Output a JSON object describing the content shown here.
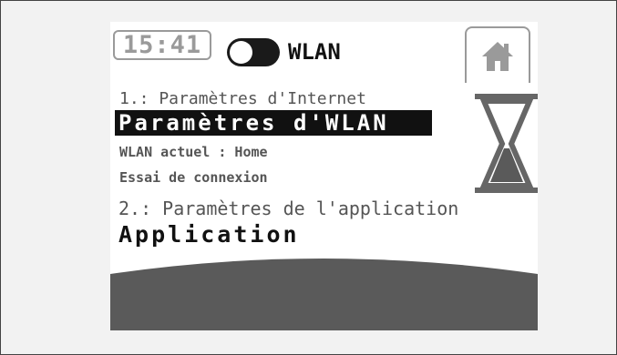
{
  "status_bar": {
    "time": "15:41",
    "wlan_toggle_state": "on",
    "wlan_label": "WLAN"
  },
  "home_button": {
    "icon": "home-icon"
  },
  "menu": {
    "section1_label": "1.: Paramètres d'Internet",
    "selected_item": "Paramètres d'WLAN",
    "current_wlan": "WLAN actuel : Home",
    "connection_test": "Essai de connexion",
    "section2_label": "2.: Paramètres de l'application",
    "application_item": "Application"
  },
  "busy_indicator": {
    "icon": "hourglass-icon"
  },
  "colors": {
    "screen_bg": "#ffffff",
    "frame_gray": "#9a9a9a",
    "highlight_bg": "#111111",
    "bottom_band": "#5a5a5a"
  }
}
